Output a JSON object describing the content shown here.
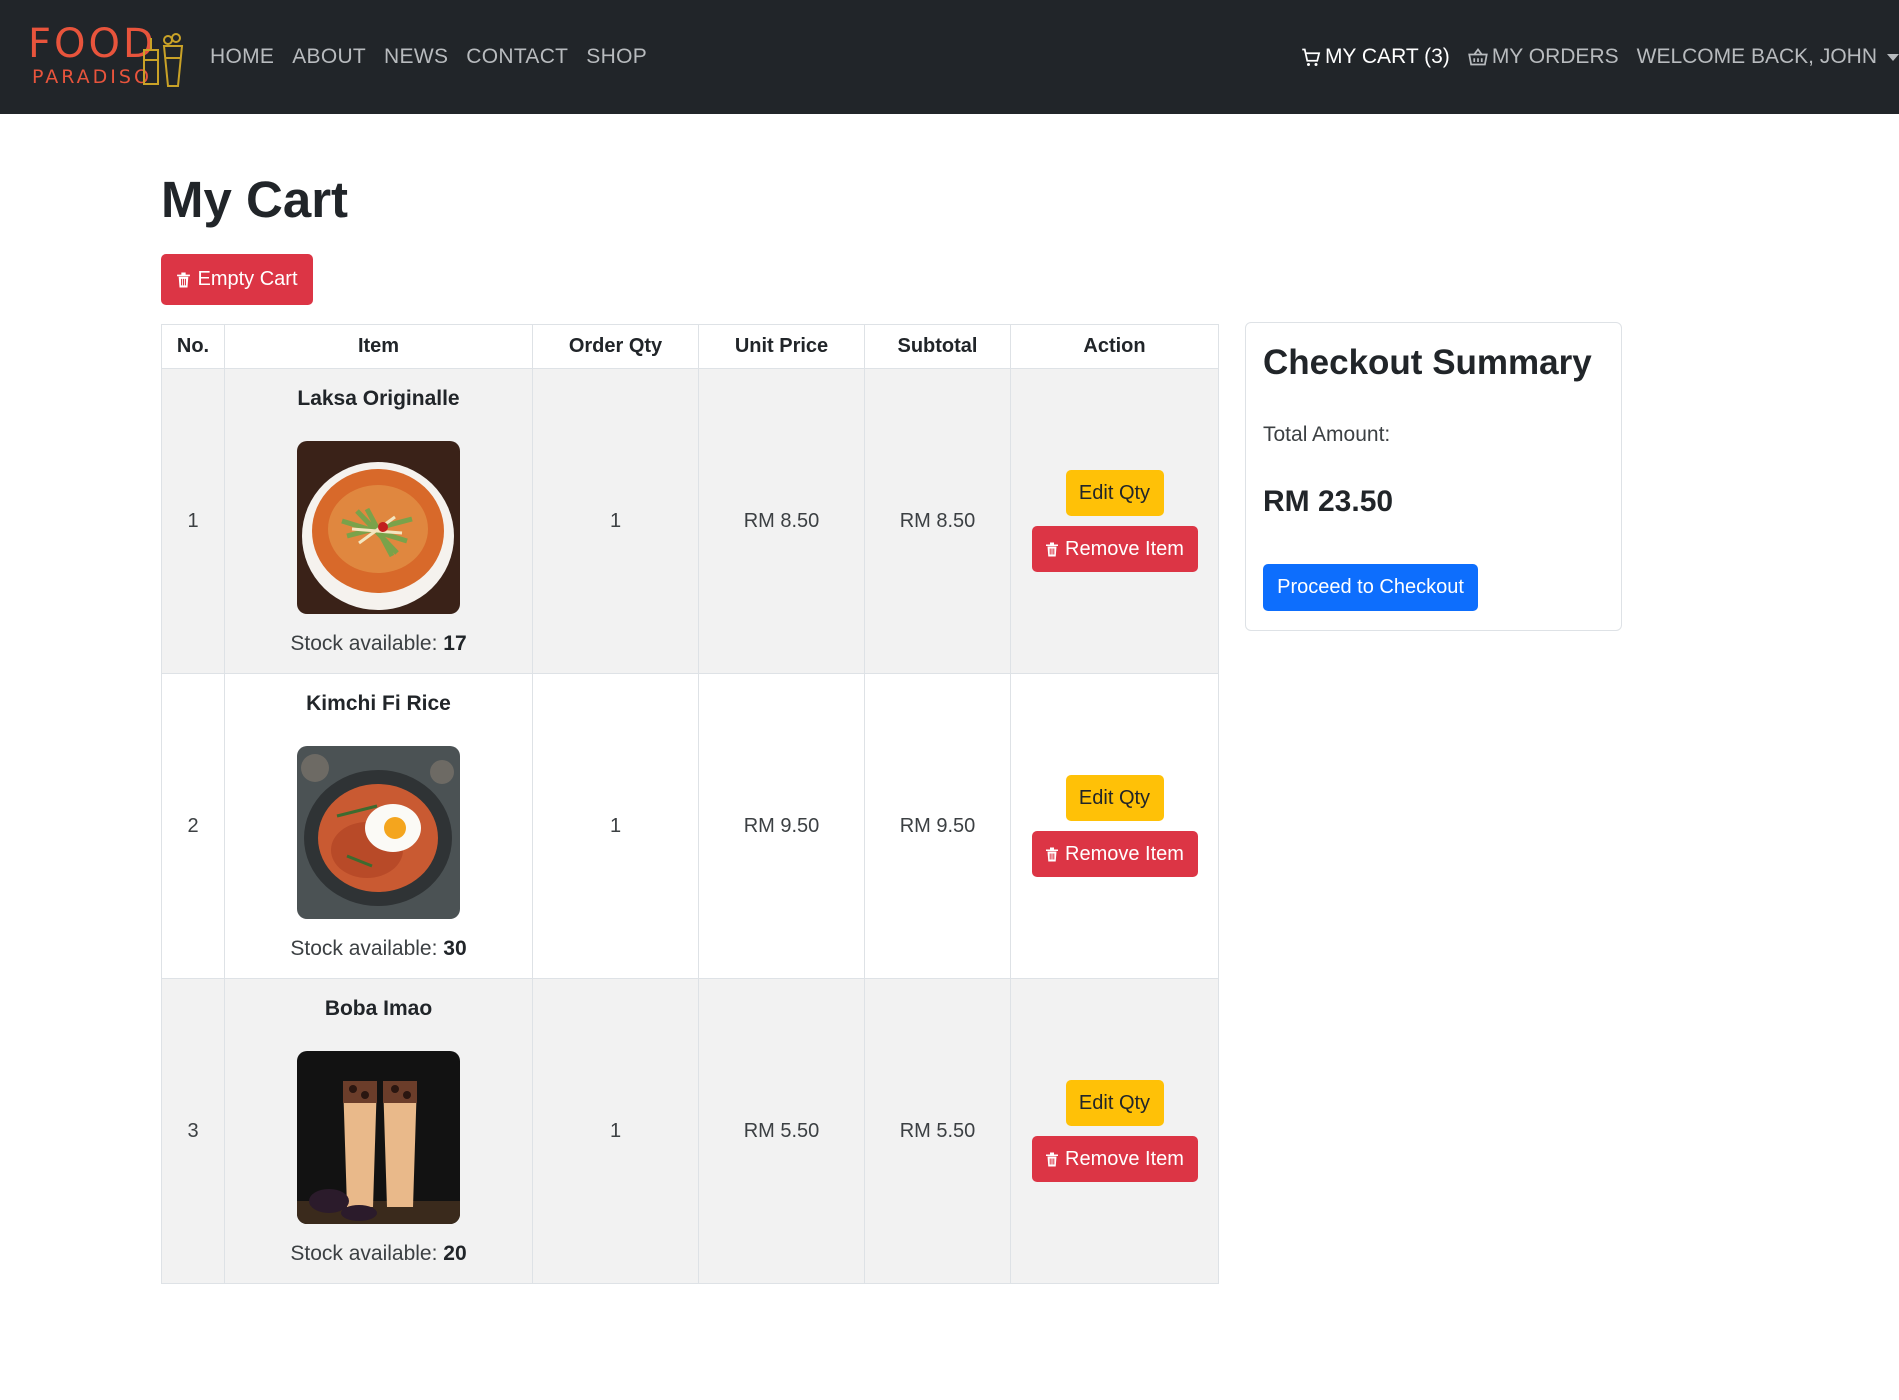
{
  "brand": {
    "logo_line1": "FOOD",
    "logo_line2": "PARADISO",
    "logo_color": "#e8543c"
  },
  "nav": {
    "links": [
      "HOME",
      "ABOUT",
      "NEWS",
      "CONTACT",
      "SHOP"
    ],
    "cart": "MY CART (3)",
    "orders": "MY ORDERS",
    "user": "WELCOME BACK, JOHN"
  },
  "page": {
    "title": "My Cart",
    "empty_cart_label": "Empty Cart"
  },
  "table": {
    "headers": [
      "No.",
      "Item",
      "Order Qty",
      "Unit Price",
      "Subtotal",
      "Action"
    ],
    "stock_label": "Stock available: ",
    "edit_label": "Edit Qty",
    "remove_label": "Remove Item",
    "rows": [
      {
        "no": "1",
        "name": "Laksa Originalle",
        "stock": "17",
        "qty": "1",
        "unit_price": "RM 8.50",
        "subtotal": "RM 8.50",
        "image": "laksa-noodle-bowl"
      },
      {
        "no": "2",
        "name": "Kimchi Fi Rice",
        "stock": "30",
        "qty": "1",
        "unit_price": "RM 9.50",
        "subtotal": "RM 9.50",
        "image": "kimchi-fried-rice-with-egg"
      },
      {
        "no": "3",
        "name": "Boba Imao",
        "stock": "20",
        "qty": "1",
        "unit_price": "RM 5.50",
        "subtotal": "RM 5.50",
        "image": "boba-milk-tea-glasses"
      }
    ]
  },
  "summary": {
    "title": "Checkout Summary",
    "total_label": "Total Amount:",
    "total_amount": "RM 23.50",
    "checkout_label": "Proceed to Checkout"
  },
  "colors": {
    "navbar": "#212529",
    "danger": "#dc3545",
    "warning": "#ffc107",
    "primary": "#0d6efd"
  }
}
